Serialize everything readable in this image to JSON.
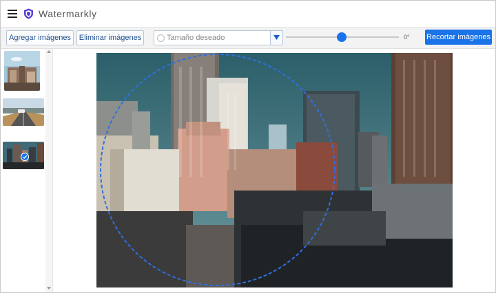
{
  "app": {
    "title": "Watermarkly"
  },
  "toolbar": {
    "add_label": "Agregar imágenes",
    "remove_label": "Eliminar imágenes",
    "size_placeholder": "Tamaño deseado",
    "rotation_value": "0°",
    "crop_label": "Recortar imágenes"
  },
  "sidebar": {
    "thumbnails": [
      {
        "name": "city-thumbnail",
        "selected": false
      },
      {
        "name": "road-thumbnail",
        "selected": false
      },
      {
        "name": "skyline-thumbnail",
        "selected": true
      }
    ]
  },
  "colors": {
    "accent": "#1a73e8",
    "crop_circle": "#2f6fe0"
  }
}
